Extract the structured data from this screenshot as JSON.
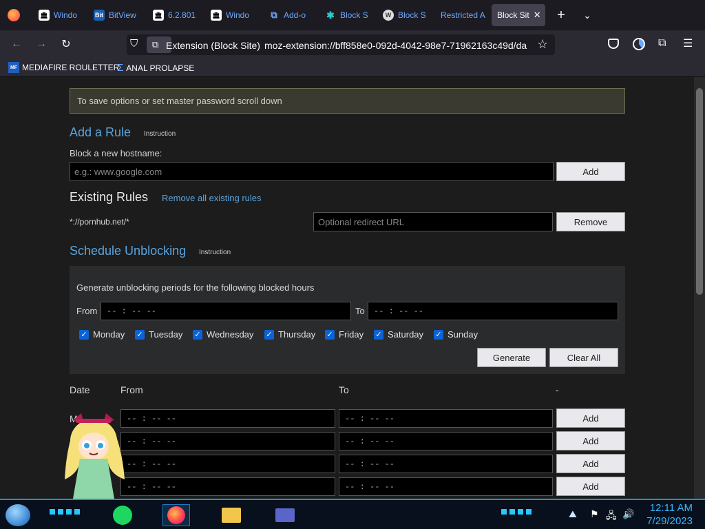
{
  "tabs": [
    {
      "label": "Windo",
      "icon": "museum-icon"
    },
    {
      "label": "BitView",
      "icon": "bitview-icon"
    },
    {
      "label": "6.2.801",
      "icon": "museum-icon"
    },
    {
      "label": "Windo",
      "icon": "museum-icon"
    },
    {
      "label": "Add-o",
      "icon": "puzzle-icon"
    },
    {
      "label": "Block S",
      "icon": "shield-icon"
    },
    {
      "label": "Block S",
      "icon": "wiki-icon"
    },
    {
      "label": "Restricted A",
      "icon": ""
    },
    {
      "label": "Block Sit",
      "icon": ""
    }
  ],
  "navbar": {
    "extension_chip": "Extension (Block Site)",
    "url": "moz-extension://bff858e0-092d-4042-98e7-71962163c49d/da"
  },
  "bookmarks": [
    {
      "label": "MEDIAFIRE ROULETTER",
      "icon": "mediafire-icon"
    },
    {
      "label": "ANAL PROLAPSE",
      "icon": "sigma-icon"
    }
  ],
  "page": {
    "notice": "To save options or set master password scroll down",
    "add_rule": {
      "title": "Add a Rule",
      "instruction": "Instruction",
      "label": "Block a new hostname:",
      "placeholder": "e.g.: www.google.com",
      "add_button": "Add"
    },
    "existing_rules": {
      "title": "Existing Rules",
      "remove_all_link": "Remove all existing rules",
      "rule_pattern": "*://pornhub.net/*",
      "redirect_placeholder": "Optional redirect URL",
      "remove_button": "Remove"
    },
    "schedule": {
      "title": "Schedule Unblocking",
      "instruction": "Instruction",
      "description": "Generate unblocking periods for the following blocked hours",
      "from_label": "From",
      "to_label": "To",
      "time_placeholder": "-- : --  --",
      "days": [
        "Monday",
        "Tuesday",
        "Wednesday",
        "Thursday",
        "Friday",
        "Saturday",
        "Sunday"
      ],
      "generate_button": "Generate",
      "clear_button": "Clear All"
    },
    "periods": {
      "headers": {
        "date": "Date",
        "from": "From",
        "to": "To",
        "dash": "-"
      },
      "rows": [
        {
          "day": "M",
          "from": "-- : --  --",
          "to": "-- : --  --",
          "add": "Add"
        },
        {
          "day": "",
          "from": "-- : --  --",
          "to": "-- : --  --",
          "add": "Add"
        },
        {
          "day": "",
          "from": "-- : --  --",
          "to": "-- : --  --",
          "add": "Add"
        },
        {
          "day": "",
          "from": "-- : --  --",
          "to": "-- : --  --",
          "add": "Add"
        }
      ]
    }
  },
  "taskbar": {
    "time": "12:11 AM",
    "date": "7/29/2023"
  },
  "colors": {
    "accent_blue": "#5ba4dd",
    "checkbox_blue": "#0b63d6",
    "taskbar_cyan": "#39b7ff"
  }
}
